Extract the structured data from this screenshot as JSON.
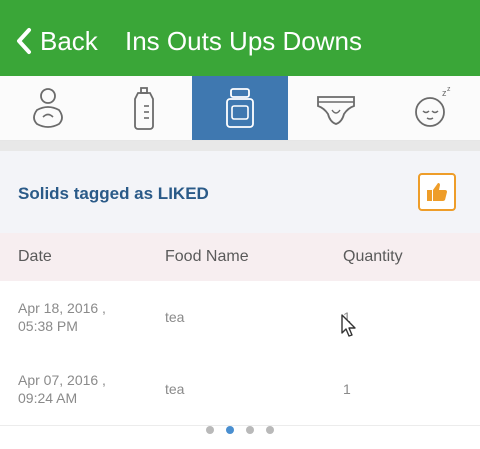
{
  "header": {
    "back_label": "Back",
    "title": "Ins Outs Ups Downs",
    "color": "#3aa638"
  },
  "tabs": [
    {
      "icon": "baby-bottle-feed-icon",
      "active": false
    },
    {
      "icon": "bottle-icon",
      "active": false
    },
    {
      "icon": "baby-food-jar-icon",
      "active": true
    },
    {
      "icon": "diaper-icon",
      "active": false
    },
    {
      "icon": "sleeping-baby-icon",
      "active": false
    }
  ],
  "section": {
    "title": "Solids tagged as LIKED",
    "like_icon": "thumbs-up-icon"
  },
  "table": {
    "headers": [
      "Date",
      "Food Name",
      "Quantity"
    ],
    "rows": [
      {
        "date_line1": "Apr 18, 2016 ,",
        "date_line2": "05:38 PM",
        "food": "tea",
        "quantity": "1"
      },
      {
        "date_line1": "Apr 07, 2016 ,",
        "date_line2": "09:24 AM",
        "food": "tea",
        "quantity": "1"
      }
    ]
  },
  "pager": {
    "count": 4,
    "active_index": 1
  }
}
